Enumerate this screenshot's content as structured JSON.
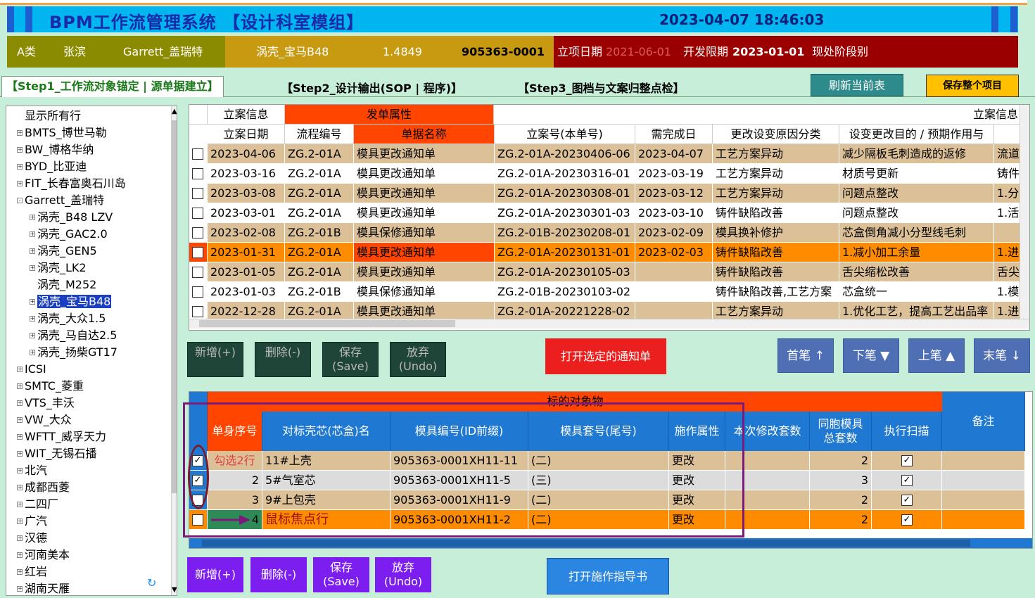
{
  "title": "BPM工作流管理系统 【设计科室模组】",
  "datetime": "2023-04-07 18:46:03",
  "info": {
    "category": "A类",
    "manager": "张滨",
    "customer": "Garrett_盖瑞特",
    "project": "涡壳_宝马B48",
    "weight": "1.4849",
    "code": "905363-0001",
    "start_label": "立项日期",
    "start_date": "2021-06-01",
    "dev_label": "开发限期",
    "dev_date": "2023-01-01",
    "stage_label": "现处阶段别"
  },
  "steps": {
    "step1": "【Step1_工作流对象锚定 | 源单据建立】",
    "step2": "【Step2_设计输出(SOP | 程序)】",
    "step3": "【Step3_图档与文案归整点检】"
  },
  "buttons": {
    "refresh": "刷新当前表",
    "save_all": "保存整个项目",
    "add": "新增(+)",
    "delete": "删除(-)",
    "save": "保存",
    "save_en": "(Save)",
    "undo": "放弃",
    "undo_en": "(Undo)",
    "open_notice": "打开选定的通知单",
    "first": "首笔 ↑",
    "next": "下笔 ▼",
    "prev": "上笔 ▲",
    "last": "末笔 ↓",
    "open_guide": "打开施作指导书"
  },
  "tree": {
    "items": [
      {
        "label": "显示所有行",
        "level": 0,
        "toggle": ""
      },
      {
        "label": "BMTS_博世马勒",
        "level": 0,
        "toggle": "+"
      },
      {
        "label": "BW_博格华纳",
        "level": 0,
        "toggle": "+"
      },
      {
        "label": "BYD_比亚迪",
        "level": 0,
        "toggle": "+"
      },
      {
        "label": "FIT_长春富奥石川岛",
        "level": 0,
        "toggle": "+"
      },
      {
        "label": "Garrett_盖瑞特",
        "level": 0,
        "toggle": "-"
      },
      {
        "label": "涡壳_B48 LZV",
        "level": 1,
        "toggle": "+"
      },
      {
        "label": "涡壳_GAC2.0",
        "level": 1,
        "toggle": "+"
      },
      {
        "label": "涡壳_GEN5",
        "level": 1,
        "toggle": "+"
      },
      {
        "label": "涡壳_LK2",
        "level": 1,
        "toggle": "+"
      },
      {
        "label": "涡壳_M252",
        "level": 1,
        "toggle": ""
      },
      {
        "label": "涡壳_宝马B48",
        "level": 1,
        "toggle": "+",
        "selected": true
      },
      {
        "label": "涡壳_大众1.5",
        "level": 1,
        "toggle": "+"
      },
      {
        "label": "涡壳_马自达2.5",
        "level": 1,
        "toggle": "+"
      },
      {
        "label": "涡壳_扬柴GT17",
        "level": 1,
        "toggle": "+"
      },
      {
        "label": "ICSI",
        "level": 0,
        "toggle": "+"
      },
      {
        "label": "SMTC_菱重",
        "level": 0,
        "toggle": "+"
      },
      {
        "label": "VTS_丰沃",
        "level": 0,
        "toggle": "+"
      },
      {
        "label": "VW_大众",
        "level": 0,
        "toggle": "+"
      },
      {
        "label": "WFTT_威孚天力",
        "level": 0,
        "toggle": "+"
      },
      {
        "label": "WIT_无锡石播",
        "level": 0,
        "toggle": "+"
      },
      {
        "label": "北汽",
        "level": 0,
        "toggle": "+"
      },
      {
        "label": "成都西菱",
        "level": 0,
        "toggle": "+"
      },
      {
        "label": "二四厂",
        "level": 0,
        "toggle": "+"
      },
      {
        "label": "广汽",
        "level": 0,
        "toggle": "+"
      },
      {
        "label": "汉德",
        "level": 0,
        "toggle": "+"
      },
      {
        "label": "河南美本",
        "level": 0,
        "toggle": "+"
      },
      {
        "label": "红岩",
        "level": 0,
        "toggle": "+"
      },
      {
        "label": "湖南天雁",
        "level": 0,
        "toggle": "+"
      }
    ]
  },
  "grid1": {
    "group_headers": [
      "立案信息",
      "发单属性",
      "立案信息"
    ],
    "columns": [
      "立案日期",
      "流程编号",
      "单据名称",
      "立案号(本单号)",
      "需完成日",
      "更改设变原因分类",
      "设变更改目的 / 预期作用与"
    ],
    "rows": [
      {
        "date": "2023-04-06",
        "flow": "ZG.2-01A",
        "name": "模具更改通知单",
        "no": "ZG.2-01A-20230406-06",
        "due": "2023-04-07",
        "reason": "工艺方案异动",
        "purpose": "减少隔板毛刺造成的返修",
        "extra": "流道",
        "style": "tan"
      },
      {
        "date": "2023-03-16",
        "flow": "ZG.2-01A",
        "name": "模具更改通知单",
        "no": "ZG.2-01A-20230316-01",
        "due": "2023-03-19",
        "reason": "工艺方案异动",
        "purpose": "材质号更新",
        "extra": "铸件",
        "style": "white"
      },
      {
        "date": "2023-03-08",
        "flow": "ZG.2-01A",
        "name": "模具更改通知单",
        "no": "ZG.2-01A-20230308-01",
        "due": "2023-03-12",
        "reason": "工艺方案异动",
        "purpose": "问题点整改",
        "extra": "1.分",
        "style": "tan"
      },
      {
        "date": "2023-03-01",
        "flow": "ZG.2-01A",
        "name": "模具更改通知单",
        "no": "ZG.2-01A-20230301-03",
        "due": "2023-03-10",
        "reason": "铸件缺陷改善",
        "purpose": "问题点整改",
        "extra": "1.活",
        "style": "white"
      },
      {
        "date": "2023-02-08",
        "flow": "ZG.2-01B",
        "name": "模具保修通知单",
        "no": "ZG.2-01B-20230208-01",
        "due": "2023-02-09",
        "reason": "模具换补修护",
        "purpose": "芯盒倒角减小分型线毛刺",
        "extra": "",
        "style": "tan"
      },
      {
        "date": "2023-01-31",
        "flow": "ZG.2-01A",
        "name": "模具更改通知单",
        "no": "ZG.2-01A-20230131-01",
        "due": "2023-02-03",
        "reason": "铸件缺陷改善",
        "purpose": "1.减小加工余量",
        "extra": "1.进",
        "style": "orange"
      },
      {
        "date": "2023-01-05",
        "flow": "ZG.2-01A",
        "name": "模具更改通知单",
        "no": "ZG.2-01A-20230105-03",
        "due": "",
        "reason": "铸件缺陷改善",
        "purpose": "舌尖缩松改善",
        "extra": "舌尖",
        "style": "tan"
      },
      {
        "date": "2023-01-03",
        "flow": "ZG.2-01B",
        "name": "模具保修通知单",
        "no": "ZG.2-01B-20230103-02",
        "due": "",
        "reason": "铸件缺陷改善,工艺方案",
        "purpose": "芯盒统一",
        "extra": "1.模",
        "style": "white"
      },
      {
        "date": "2022-12-28",
        "flow": "ZG.2-01A",
        "name": "模具更改通知单",
        "no": "ZG.2-01A-20221228-02",
        "due": "",
        "reason": "工艺方案异动",
        "purpose": "1.优化工艺，提高工艺出品率",
        "extra": "1.进",
        "style": "tan"
      }
    ]
  },
  "grid2": {
    "group_header": "标的对象物",
    "columns": [
      "单身序号",
      "对标壳芯(芯盒)名",
      "模具编号(ID前缀)",
      "模具套号(尾号)",
      "施作属性",
      "本次修改套数",
      "同胞模具总套数",
      "执行扫描",
      "备注"
    ],
    "rows": [
      {
        "seq": "勾选2行",
        "name": "11#上壳",
        "mold": "905363-0001XH11-11",
        "set": "(二)",
        "attr": "更改",
        "count": "",
        "total": "2",
        "checked": true,
        "style": "tan"
      },
      {
        "seq": "2",
        "name": "5#气室芯",
        "mold": "905363-0001XH11-5",
        "set": "(三)",
        "attr": "更改",
        "count": "",
        "total": "3",
        "checked": true,
        "style": "grey"
      },
      {
        "seq": "3",
        "name": "9#上包壳",
        "mold": "905363-0001XH11-9",
        "set": "(二)",
        "attr": "更改",
        "count": "",
        "total": "2",
        "checked": false,
        "style": "tan"
      },
      {
        "seq": "4",
        "name": "鼠标焦点行",
        "mold": "905363-0001XH11-2",
        "set": "(二)",
        "attr": "更改",
        "count": "",
        "total": "2",
        "checked": false,
        "style": "orange"
      }
    ]
  },
  "colors": {
    "title_bg": "#00b5f0",
    "tan_row": "#dcc098",
    "orange_row": "#ff8c00",
    "red_header": "#ff4500",
    "blue_header": "#1f78d1",
    "annotation": "#7c1a7c"
  }
}
